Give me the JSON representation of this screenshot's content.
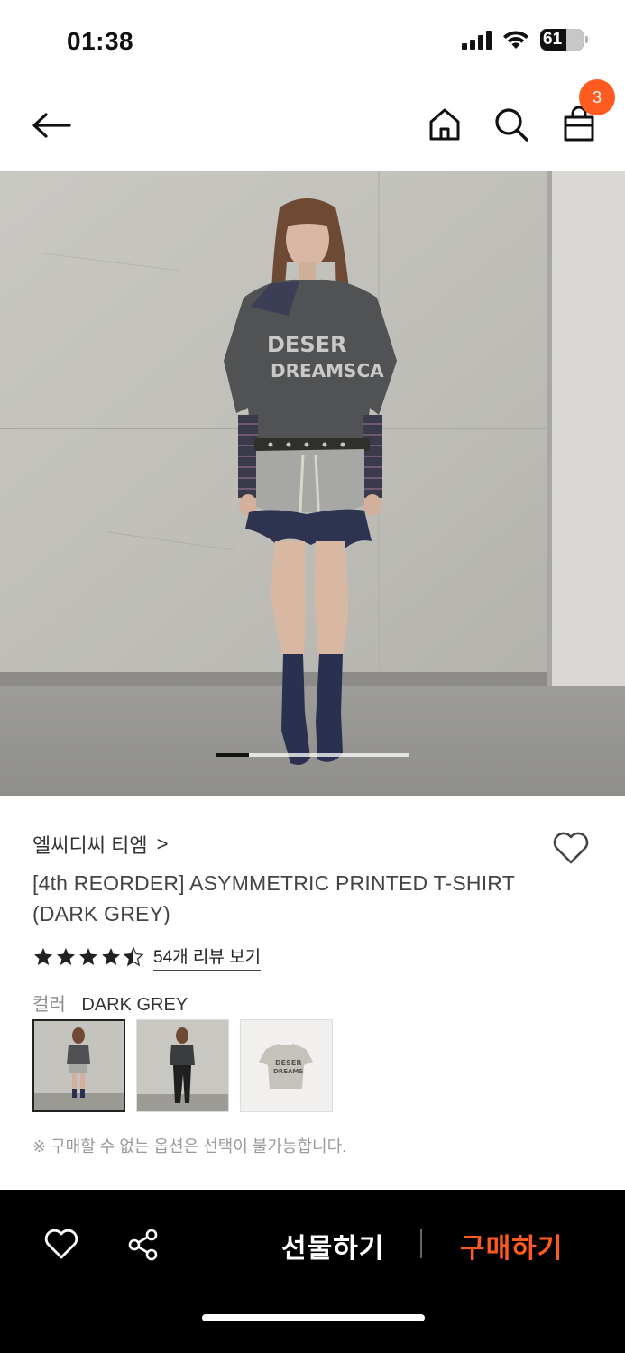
{
  "status_bar": {
    "time": "01:38",
    "battery": "61",
    "battery_level": 0.61
  },
  "nav": {
    "back_icon": "arrow-left-icon",
    "home_icon": "home-icon",
    "search_icon": "search-icon",
    "cart_icon": "shopping-bag-icon",
    "cart_count": "3",
    "badge_color": "#ff5a1f"
  },
  "gallery": {
    "current_page": 1,
    "total_pages": 6
  },
  "product": {
    "brand": "엘씨디씨 티엠",
    "brand_chevron": ">",
    "title": "[4th REORDER] ASYMMETRIC PRINTED T-SHIRT (DARK GREY)",
    "rating": 4.5,
    "review_link": "54개 리뷰 보기",
    "color_label": "컬러",
    "color_value": "DARK GREY",
    "swatches": [
      {
        "name": "model-front",
        "selected": true
      },
      {
        "name": "model-styled",
        "selected": false
      },
      {
        "name": "product-flat",
        "selected": false
      }
    ],
    "notice": "※ 구매할 수 없는 옵션은 선택이 불가능합니다."
  },
  "bottom_bar": {
    "wish_icon": "heart-icon",
    "share_icon": "share-icon",
    "gift_label": "선물하기",
    "buy_label": "구매하기",
    "buy_color": "#ff5a1f"
  }
}
